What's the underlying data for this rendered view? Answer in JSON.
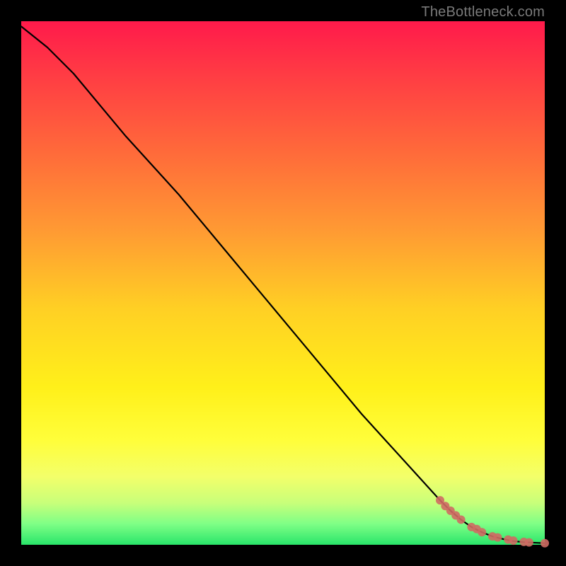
{
  "attribution": "TheBottleneck.com",
  "chart_data": {
    "type": "line",
    "title": "",
    "xlabel": "",
    "ylabel": "",
    "xlim": [
      0,
      100
    ],
    "ylim": [
      0,
      100
    ],
    "background_gradient": {
      "top": "#ff1a4b",
      "mid": "#fff01a",
      "bottom": "#29e56a"
    },
    "series": [
      {
        "name": "bottleneck-curve",
        "type": "line",
        "color": "#000000",
        "x": [
          0,
          5,
          10,
          15,
          20,
          25,
          30,
          35,
          40,
          45,
          50,
          55,
          60,
          65,
          70,
          75,
          80,
          82,
          84,
          86,
          88,
          90,
          92,
          94,
          96,
          98,
          100
        ],
        "y": [
          99,
          95,
          90,
          84,
          78,
          72.5,
          67,
          61,
          55,
          49,
          43,
          37,
          31,
          25,
          19.5,
          14,
          8.5,
          6.5,
          4.8,
          3.4,
          2.4,
          1.6,
          1.1,
          0.7,
          0.5,
          0.4,
          0.3
        ]
      },
      {
        "name": "tail-points",
        "type": "scatter",
        "color": "#cf6a63",
        "x": [
          80,
          81,
          82,
          83,
          84,
          86,
          87,
          88,
          90,
          91,
          93,
          94,
          96,
          97,
          100
        ],
        "y": [
          8.5,
          7.4,
          6.5,
          5.6,
          4.8,
          3.4,
          3.0,
          2.4,
          1.6,
          1.4,
          1.0,
          0.8,
          0.56,
          0.45,
          0.3
        ]
      }
    ]
  }
}
